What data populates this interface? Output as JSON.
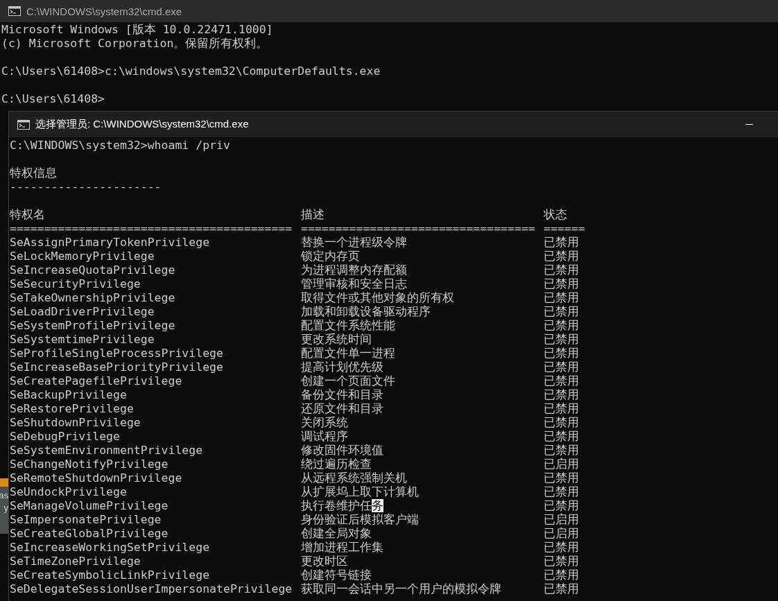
{
  "back_window": {
    "title": "C:\\WINDOWS\\system32\\cmd.exe",
    "paragraphs": [
      [
        "Microsoft Windows [版本 10.0.22471.1000]",
        "(c) Microsoft Corporation。保留所有权利。"
      ],
      [
        "C:\\Users\\61408>c:\\windows\\system32\\ComputerDefaults.exe"
      ],
      [
        "C:\\Users\\61408>"
      ]
    ],
    "behind_fragments": [
      "as",
      "y"
    ]
  },
  "front_window": {
    "title": "选择管理员: C:\\WINDOWS\\system32\\cmd.exe",
    "command": "C:\\WINDOWS\\system32>whoami /priv",
    "heading": "特权信息",
    "heading_rule": "----------------------",
    "columns": [
      {
        "label": "特权名",
        "rule": "========================================="
      },
      {
        "label": "描述",
        "rule": "=================================="
      },
      {
        "label": "状态",
        "rule": "======"
      }
    ],
    "rows": [
      {
        "name": "SeAssignPrimaryTokenPrivilege",
        "description": "替换一个进程级令牌",
        "state": "已禁用"
      },
      {
        "name": "SeLockMemoryPrivilege",
        "description": "锁定内存页",
        "state": "已禁用"
      },
      {
        "name": "SeIncreaseQuotaPrivilege",
        "description": "为进程调整内存配额",
        "state": "已禁用"
      },
      {
        "name": "SeSecurityPrivilege",
        "description": "管理审核和安全日志",
        "state": "已禁用"
      },
      {
        "name": "SeTakeOwnershipPrivilege",
        "description": "取得文件或其他对象的所有权",
        "state": "已禁用"
      },
      {
        "name": "SeLoadDriverPrivilege",
        "description": "加载和卸载设备驱动程序",
        "state": "已禁用"
      },
      {
        "name": "SeSystemProfilePrivilege",
        "description": "配置文件系统性能",
        "state": "已禁用"
      },
      {
        "name": "SeSystemtimePrivilege",
        "description": "更改系统时间",
        "state": "已禁用"
      },
      {
        "name": "SeProfileSingleProcessPrivilege",
        "description": "配置文件单一进程",
        "state": "已禁用"
      },
      {
        "name": "SeIncreaseBasePriorityPrivilege",
        "description": "提高计划优先级",
        "state": "已禁用"
      },
      {
        "name": "SeCreatePagefilePrivilege",
        "description": "创建一个页面文件",
        "state": "已禁用"
      },
      {
        "name": "SeBackupPrivilege",
        "description": "备份文件和目录",
        "state": "已禁用"
      },
      {
        "name": "SeRestorePrivilege",
        "description": "还原文件和目录",
        "state": "已禁用"
      },
      {
        "name": "SeShutdownPrivilege",
        "description": "关闭系统",
        "state": "已禁用"
      },
      {
        "name": "SeDebugPrivilege",
        "description": "调试程序",
        "state": "已禁用"
      },
      {
        "name": "SeSystemEnvironmentPrivilege",
        "description": "修改固件环境值",
        "state": "已禁用"
      },
      {
        "name": "SeChangeNotifyPrivilege",
        "description": "绕过遍历检查",
        "state": "已启用"
      },
      {
        "name": "SeRemoteShutdownPrivilege",
        "description": "从远程系统强制关机",
        "state": "已禁用"
      },
      {
        "name": "SeUndockPrivilege",
        "description": "从扩展坞上取下计算机",
        "state": "已禁用"
      },
      {
        "name": "SeManageVolumePrivilege",
        "description": "执行卷维护任",
        "selected_text": "务",
        "state": "已禁用"
      },
      {
        "name": "SeImpersonatePrivilege",
        "description": "身份验证后模拟客户端",
        "state": "已启用"
      },
      {
        "name": "SeCreateGlobalPrivilege",
        "description": "创建全局对象",
        "state": "已启用"
      },
      {
        "name": "SeIncreaseWorkingSetPrivilege",
        "description": "增加进程工作集",
        "state": "已禁用"
      },
      {
        "name": "SeTimeZonePrivilege",
        "description": "更改时区",
        "state": "已禁用"
      },
      {
        "name": "SeCreateSymbolicLinkPrivilege",
        "description": "创建符号链接",
        "state": "已禁用"
      },
      {
        "name": "SeDelegateSessionUserImpersonatePrivilege",
        "description": "获取同一会话中另一个用户的模拟令牌",
        "state": "已禁用"
      }
    ]
  }
}
